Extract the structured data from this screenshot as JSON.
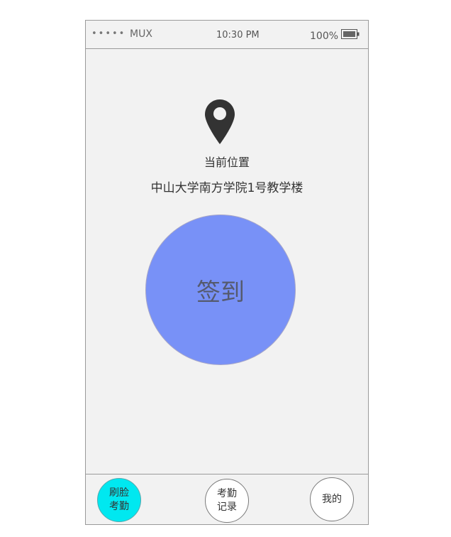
{
  "status_bar": {
    "signal": "•••••",
    "carrier": "MUX",
    "time": "10:30 PM",
    "battery": "100%"
  },
  "location": {
    "icon": "map-pin-icon",
    "label": "当前位置",
    "name": "中山大学南方学院1号教学楼"
  },
  "checkin": {
    "label": "签到",
    "color": "#7891f7"
  },
  "tabs": [
    {
      "label": "刷脸考勤",
      "active": true
    },
    {
      "label": "考勤记录",
      "active": false
    },
    {
      "label": "我的",
      "active": false
    }
  ],
  "colors": {
    "active_tab": "#00e8f0",
    "background": "#f2f2f2"
  }
}
